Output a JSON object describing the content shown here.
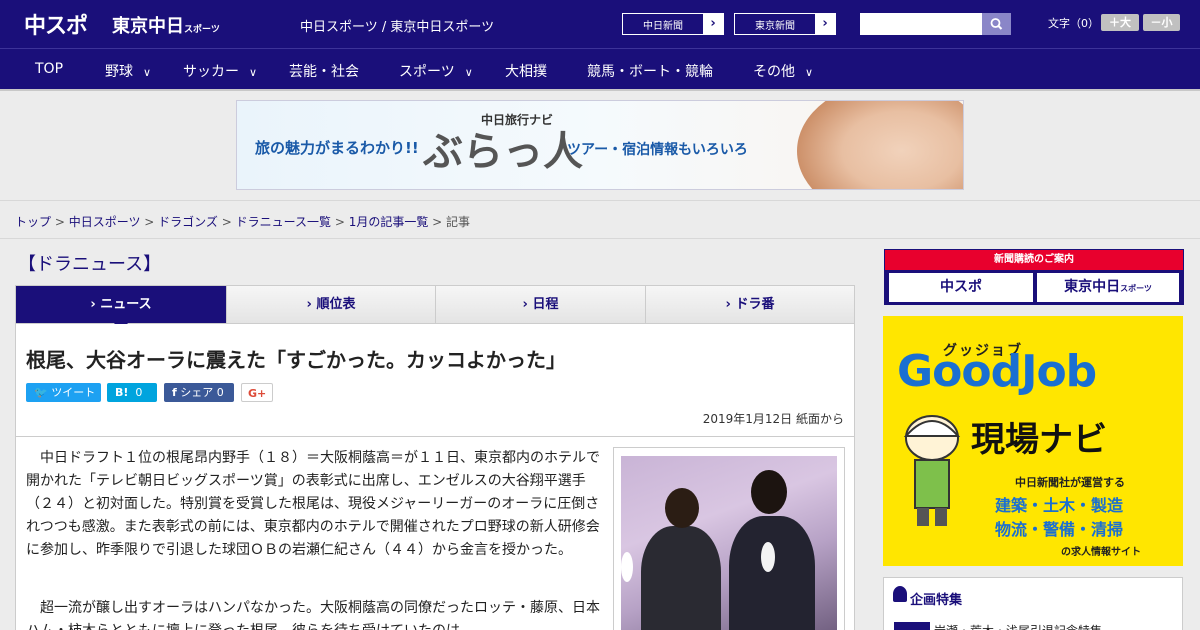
{
  "header": {
    "logo": "中スポ",
    "logo2": "東京中日",
    "logo2_small": "スポーツ",
    "site_title": "中日スポーツ / 東京中日スポーツ",
    "links": [
      {
        "label": "中日新聞"
      },
      {
        "label": "東京新聞"
      }
    ],
    "font_label": "文字（0）",
    "font_plus": "＋大",
    "font_minus": "－小"
  },
  "nav": {
    "items": [
      {
        "label": "TOP",
        "has_menu": false
      },
      {
        "label": "野球",
        "has_menu": true
      },
      {
        "label": "サッカー",
        "has_menu": true
      },
      {
        "label": "芸能・社会",
        "has_menu": false
      },
      {
        "label": "スポーツ",
        "has_menu": true
      },
      {
        "label": "大相撲",
        "has_menu": false
      },
      {
        "label": "競馬・ボート・競輪",
        "has_menu": false
      },
      {
        "label": "その他",
        "has_menu": true
      }
    ]
  },
  "ad": {
    "left_text": "旅の魅力がまるわかり!!",
    "small_text": "中日旅行ナビ",
    "brand": "ぶらっ人",
    "right_text": "ツアー・宿泊情報もいろいろ"
  },
  "breadcrumb": {
    "items": [
      "トップ",
      "中日スポーツ",
      "ドラゴンズ",
      "ドラニュース一覧",
      "1月の記事一覧"
    ],
    "current": "記事",
    "sep": " > "
  },
  "section": {
    "title": "【ドラニュース】"
  },
  "tabs": [
    {
      "label": "ニュース",
      "active": true
    },
    {
      "label": "順位表",
      "active": false
    },
    {
      "label": "日程",
      "active": false
    },
    {
      "label": "ドラ番",
      "active": false
    }
  ],
  "article": {
    "headline": "根尾、大谷オーラに震えた「すごかった。カッコよかった」",
    "share": {
      "tweet": "ツイート",
      "hatena": "B!",
      "hatena_count": "0",
      "facebook": "シェア",
      "facebook_count": "0",
      "gplus": "G+"
    },
    "date": "2019年1月12日 紙面から",
    "paragraphs": [
      "　中日ドラフト１位の根尾昂内野手（１８）＝大阪桐蔭高＝が１１日、東京都内のホテルで開かれた「テレビ朝日ビッグスポーツ賞」の表彰式に出席し、エンゼルスの大谷翔平選手（２４）と初対面した。特別賞を受賞した根尾は、現役メジャーリーガーのオーラに圧倒されつつも感激。また表彰式の前には、東京都内のホテルで開催されたプロ野球の新人研修会に参加し、昨季限りで引退した球団ＯＢの岩瀬仁紀さん（４４）から金言を授かった。",
      "　超一流が醸し出すオーラはハンパなかった。大阪桐蔭高の同僚だったロッテ・藤原、日本ハム・柿木らとともに壇上に登った根尾。彼らを待ち受けていたのは"
    ]
  },
  "sidebar": {
    "subscribe_head": "新聞購読のご案内",
    "subscribe_buttons": [
      "中スポ",
      "東京中日"
    ],
    "subscribe_small": "スポーツ",
    "goodjob": {
      "sub": "グッジョブ",
      "title": "GoodJob",
      "navi": "現場ナビ",
      "small": "中日新聞社が運営する",
      "lines": [
        "建築・土木・製造",
        "物流・警備・清掃"
      ],
      "foot": "の求人情報サイト"
    },
    "feature": {
      "title": "企画特集",
      "item": "岩瀬・荒木・浅尾引退記念特集"
    }
  },
  "colors": {
    "brand_navy": "#1a0f7a",
    "accent_red": "#e8002d",
    "twitter": "#1da1f2",
    "hatena": "#00a4de",
    "facebook": "#3b5998",
    "goodjob_yellow": "#ffe600"
  }
}
